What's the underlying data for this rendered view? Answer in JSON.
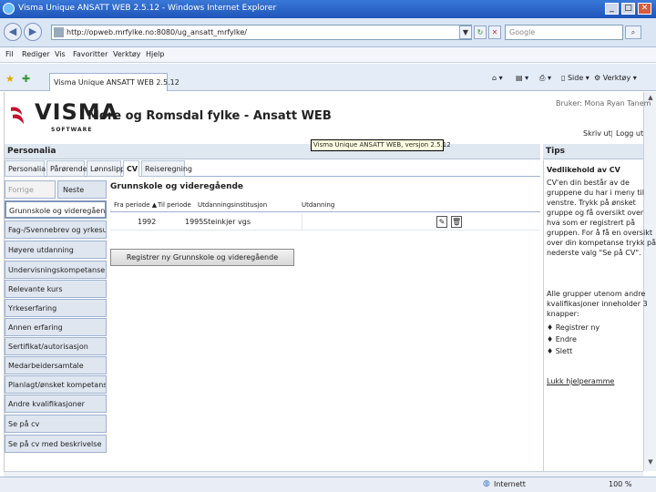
{
  "window": {
    "title": "Visma Unique ANSATT WEB 2.5.12 - Windows Internet Explorer",
    "minimize_glyph": "_",
    "maximize_glyph": "□",
    "close_glyph": "✕"
  },
  "address_bar": {
    "url": "http://opweb.mrfylke.no:8080/ug_ansatt_mrfylke/",
    "search_placeholder": "Google"
  },
  "menu": [
    "Fil",
    "Rediger",
    "Vis",
    "Favoritter",
    "Verktøy",
    "Hjelp"
  ],
  "browser_tab": {
    "title": "Visma Unique ANSATT WEB 2.5.12"
  },
  "command_bar": {
    "side": "Side",
    "verktoy": "Verktøy"
  },
  "header": {
    "logo_text": "VISMA",
    "logo_sub": "SOFTWARE",
    "app_title": "Møre og Romsdal fylke - Ansatt WEB",
    "user_line": "Bruker: Mona Ryan Tanem",
    "skriv_ut": "Skriv ut",
    "separator": "|",
    "logg_ut": "Logg ut",
    "tooltip": "Visma Unique ANSATT WEB, versjon 2.5.12"
  },
  "section": {
    "title": "Personalia",
    "tips_title": "Tips"
  },
  "tabs": [
    "Personalia",
    "Pårørende",
    "Lønnslipp",
    "CV",
    "Reiseregning"
  ],
  "sidebar": {
    "prev": "Forrige",
    "next": "Neste",
    "items": [
      "Grunnskole og videregående",
      "Fag-/Svennebrev og yrkesutvikling",
      "Høyere utdanning",
      "Undervisningskompetanse",
      "Relevante kurs",
      "Yrkeserfaring",
      "Annen erfaring",
      "Sertifikat/autorisasjon",
      "Medarbeidersamtale",
      "Planlagt/ønsket kompetanseutvikling",
      "Andre kvalifikasjoner",
      "Se på cv",
      "Se på cv med beskrivelse"
    ]
  },
  "main": {
    "heading": "Grunnskole og videregående",
    "columns": [
      "Fra periode ▲",
      "Til periode",
      "Utdanningsinstitusjon",
      "Utdanning"
    ],
    "rows": [
      {
        "from": "1992",
        "to": "1995",
        "institution": "Steinkjer vgs",
        "education": ""
      }
    ],
    "register_button": "Registrer ny Grunnskole og videregående"
  },
  "tips": {
    "title": "Vedlikehold av CV",
    "paragraph1": [
      "CV'en din består av de",
      "gruppene du har i meny til",
      "venstre. Trykk på ønsket",
      "gruppe og få oversikt over",
      "hva som er registrert på",
      "gruppen. For å få en oversikt",
      "over din kompetanse trykk på",
      "nederste valg \"Se på CV\"."
    ],
    "paragraph2": [
      "Alle grupper utenom andre",
      "kvalifikasjoner inneholder 3",
      "knapper:"
    ],
    "bullets": [
      "Registrer ny",
      "Endre",
      "Slett"
    ],
    "close_link": "Lukk hjelperamme"
  },
  "status": {
    "zone": "Internett",
    "zoom": "100 %"
  },
  "colors": {
    "title_bar": "#1f55b8",
    "visma_red": "#c8102e",
    "panel": "#dfe6ef"
  }
}
